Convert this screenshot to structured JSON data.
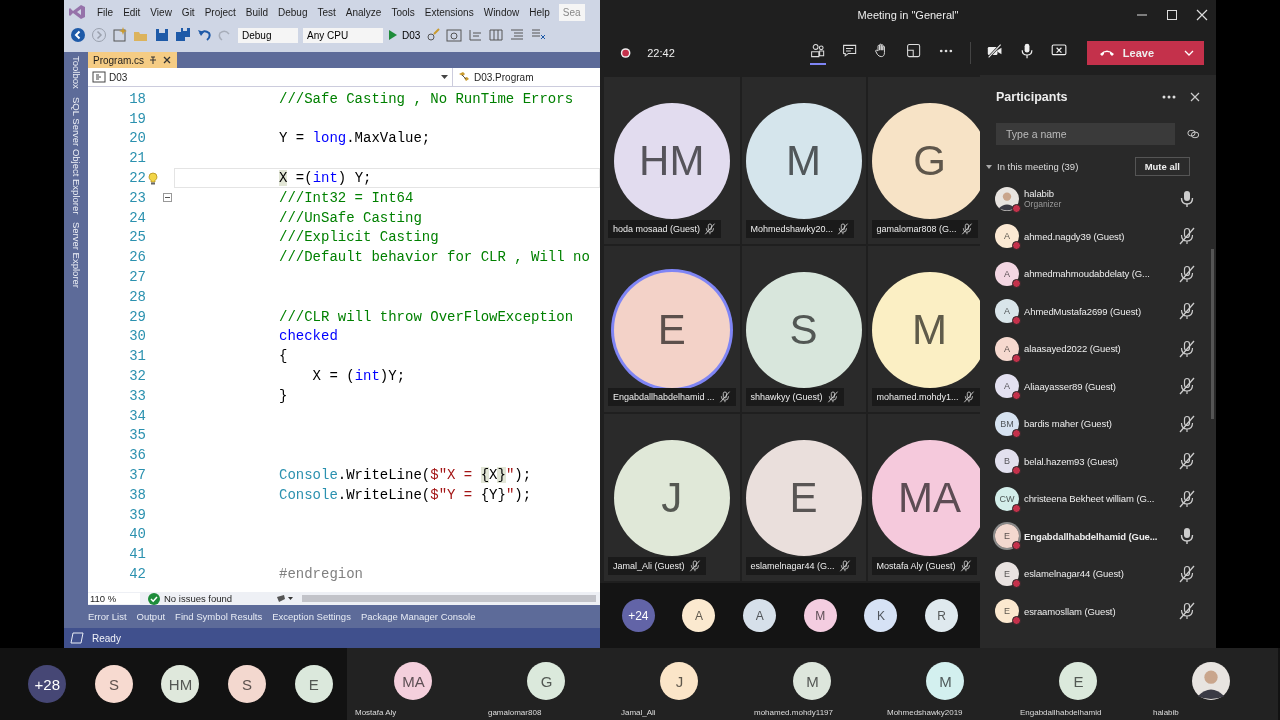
{
  "vs": {
    "menu": [
      "File",
      "Edit",
      "View",
      "Git",
      "Project",
      "Build",
      "Debug",
      "Test",
      "Analyze",
      "Tools",
      "Extensions",
      "Window",
      "Help",
      "Sea"
    ],
    "toolbar": {
      "config": "Debug",
      "platform": "Any CPU",
      "start": "D03"
    },
    "side_tabs": [
      "Toolbox",
      "SQL Server Object Explorer",
      "Server Explorer"
    ],
    "doc_tab": {
      "label": "Program.cs",
      "selected": true
    },
    "nav": {
      "project": "D03",
      "type": "D03.Program"
    },
    "code": [
      {
        "n": "18",
        "tokens": [
          {
            "t": "///Safe Casting , No RunTime Errors",
            "kind": "comment"
          }
        ]
      },
      {
        "n": "19"
      },
      {
        "n": "20",
        "tokens": [
          {
            "t": "Y = ",
            "kind": "plain"
          },
          {
            "t": "long",
            "kind": "keyword"
          },
          {
            "t": ".MaxValue;",
            "kind": "plain"
          }
        ]
      },
      {
        "n": "21"
      },
      {
        "n": "22",
        "current": true,
        "kind": "lightbulb",
        "tokens": [
          {
            "t": "X",
            "kind": "highlight"
          },
          {
            "t": " =(",
            "kind": "plain"
          },
          {
            "t": "int",
            "kind": "keyword"
          },
          {
            "t": ") Y;",
            "kind": "plain"
          }
        ]
      },
      {
        "n": "23",
        "kind": "collapse",
        "tokens": [
          {
            "t": "///Int32 = Int64",
            "kind": "comment"
          }
        ]
      },
      {
        "n": "24",
        "tokens": [
          {
            "t": "///UnSafe Casting",
            "kind": "comment"
          }
        ]
      },
      {
        "n": "25",
        "tokens": [
          {
            "t": "///Explicit Casting",
            "kind": "comment"
          }
        ]
      },
      {
        "n": "26",
        "tokens": [
          {
            "t": "///Default behavior for CLR , Will no",
            "kind": "comment"
          }
        ]
      },
      {
        "n": "27"
      },
      {
        "n": "28"
      },
      {
        "n": "29",
        "tokens": [
          {
            "t": "///CLR will throw OverFlowException",
            "kind": "comment"
          }
        ]
      },
      {
        "n": "30",
        "tokens": [
          {
            "t": "checked",
            "kind": "keyword"
          }
        ]
      },
      {
        "n": "31",
        "tokens": [
          {
            "t": "{",
            "kind": "plain"
          }
        ]
      },
      {
        "n": "32",
        "tokens": [
          {
            "t": "    X = (",
            "kind": "plain"
          },
          {
            "t": "int",
            "kind": "keyword"
          },
          {
            "t": ")Y;",
            "kind": "plain"
          }
        ]
      },
      {
        "n": "33",
        "tokens": [
          {
            "t": "}",
            "kind": "plain"
          }
        ]
      },
      {
        "n": "34"
      },
      {
        "n": "35"
      },
      {
        "n": "36"
      },
      {
        "n": "37",
        "tokens": [
          {
            "t": "Console",
            "kind": "type"
          },
          {
            "t": ".WriteLine(",
            "kind": "plain"
          },
          {
            "t": "$\"X = ",
            "kind": "string"
          },
          {
            "t": "{",
            "kind": "highlight"
          },
          {
            "t": "X",
            "kind": "plain"
          },
          {
            "t": "}",
            "kind": "highlight"
          },
          {
            "t": "\"",
            "kind": "string"
          },
          {
            "t": ");",
            "kind": "plain"
          }
        ]
      },
      {
        "n": "38",
        "tokens": [
          {
            "t": "Console",
            "kind": "type"
          },
          {
            "t": ".WriteLine(",
            "kind": "plain"
          },
          {
            "t": "$\"Y = ",
            "kind": "string"
          },
          {
            "t": "{Y}",
            "kind": "plain"
          },
          {
            "t": "\"",
            "kind": "string"
          },
          {
            "t": ");",
            "kind": "plain"
          }
        ]
      },
      {
        "n": "39"
      },
      {
        "n": "40"
      },
      {
        "n": "41"
      },
      {
        "n": "42",
        "tokens": [
          {
            "t": "#endregion",
            "kind": "preproc"
          }
        ]
      }
    ],
    "zoom": "110 %",
    "issues": "No issues found",
    "tool_tabs": [
      "Error List",
      "Output",
      "Find Symbol Results",
      "Exception Settings",
      "Package Manager Console"
    ],
    "status": "Ready"
  },
  "teams": {
    "title": "Meeting in \"General\"",
    "timer": "22:42",
    "toolbar": [
      {
        "kind": "people",
        "selected": true
      },
      {
        "kind": "chat",
        "selected": false
      },
      {
        "kind": "hand",
        "selected": false
      },
      {
        "kind": "rooms",
        "selected": false
      },
      {
        "kind": "more",
        "selected": false
      },
      {
        "kind": "camera-off",
        "selected": false
      },
      {
        "kind": "mic",
        "selected": false
      },
      {
        "kind": "share",
        "selected": false
      }
    ],
    "leave": "Leave",
    "grid": [
      {
        "initials": "HM",
        "name": "hoda mosaad (Guest)",
        "color": "#e2dcef",
        "speaking": false
      },
      {
        "initials": "M",
        "name": "Mohmedshawky20...",
        "color": "#d5e5ec",
        "speaking": false
      },
      {
        "initials": "G",
        "name": "gamalomar808 (G...",
        "color": "#f7e3c6",
        "speaking": false
      },
      {
        "initials": "E",
        "name": "Engabdallhabdelhamid ...",
        "color": "#f3d2c8",
        "speaking": true
      },
      {
        "initials": "S",
        "name": "shhawkyy (Guest)",
        "color": "#d8e6dc",
        "speaking": false
      },
      {
        "initials": "M",
        "name": "mohamed.mohdy1...",
        "color": "#fbefc4",
        "speaking": false
      },
      {
        "initials": "J",
        "name": "Jamal_Ali (Guest)",
        "color": "#e0e8d8",
        "speaking": false
      },
      {
        "initials": "E",
        "name": "eslamelnagar44 (G...",
        "color": "#eadfdc",
        "speaking": false
      },
      {
        "initials": "MA",
        "name": "Mostafa Aly (Guest)",
        "color": "#f5c9dc",
        "speaking": false
      }
    ],
    "overflow": [
      {
        "initials": "+24",
        "color": "#6264a7"
      },
      {
        "initials": "A",
        "color": "#fbe9cf"
      },
      {
        "initials": "A",
        "color": "#d6e0ea"
      },
      {
        "initials": "M",
        "color": "#f4cde0"
      },
      {
        "initials": "K",
        "color": "#d6e2f5"
      },
      {
        "initials": "R",
        "color": "#dfe9ee"
      }
    ],
    "participants": {
      "title": "Participants",
      "search_placeholder": "Type a name",
      "section": "In this meeting (39)",
      "mute_all": "Mute all",
      "people": [
        {
          "kind": "photo",
          "name": "halabib",
          "role": "Organizer",
          "muted": false,
          "speaking": false
        },
        {
          "kind": "initials",
          "initials": "A",
          "name": "ahmed.nagdy39 (Guest)",
          "color": "#fbe9d3",
          "muted": true,
          "speaking": false
        },
        {
          "kind": "initials",
          "initials": "A",
          "name": "ahmedmahmoudabdelaty (G...",
          "color": "#f3d6e2",
          "muted": true,
          "speaking": false
        },
        {
          "kind": "initials",
          "initials": "A",
          "name": "AhmedMustafa2699 (Guest)",
          "color": "#d9e5ea",
          "muted": true,
          "speaking": false
        },
        {
          "kind": "initials",
          "initials": "A",
          "name": "alaasayed2022 (Guest)",
          "color": "#f6d9cf",
          "muted": true,
          "speaking": false
        },
        {
          "kind": "initials",
          "initials": "A",
          "name": "Aliaayasser89 (Guest)",
          "color": "#e3e0f0",
          "muted": true,
          "speaking": false
        },
        {
          "kind": "initials",
          "initials": "BM",
          "name": "bardis maher (Guest)",
          "color": "#d6e2f0",
          "muted": true,
          "speaking": false
        },
        {
          "kind": "initials",
          "initials": "B",
          "name": "belal.hazem93 (Guest)",
          "color": "#e2e0ee",
          "muted": true,
          "speaking": false
        },
        {
          "kind": "initials",
          "initials": "CW",
          "name": "christeena Bekheet william (G...",
          "color": "#d3eeea",
          "muted": true,
          "speaking": false
        },
        {
          "kind": "initials",
          "initials": "E",
          "name": "Engabdallhabdelhamid (Gue...",
          "color": "#f3d8cf",
          "muted": false,
          "speaking": true
        },
        {
          "kind": "initials",
          "initials": "E",
          "name": "eslamelnagar44 (Guest)",
          "color": "#e8e2e0",
          "muted": true,
          "speaking": false
        },
        {
          "kind": "initials",
          "initials": "E",
          "name": "esraamosllam (Guest)",
          "color": "#fbe8cf",
          "muted": true,
          "speaking": false
        }
      ]
    }
  },
  "strip": [
    {
      "kind": "circle",
      "initials": "+28",
      "color": "#464775"
    },
    {
      "kind": "circle",
      "initials": "S",
      "color": "#f7dad0"
    },
    {
      "kind": "circle",
      "initials": "HM",
      "color": "#dfe8dc"
    },
    {
      "kind": "circle",
      "initials": "S",
      "color": "#f3d8cf"
    },
    {
      "kind": "circle",
      "initials": "E",
      "color": "#dbe8dc"
    },
    {
      "kind": "tile",
      "initials": "MA",
      "name": "Mostafa Aly",
      "color": "#f4cfdc"
    },
    {
      "kind": "tile",
      "initials": "G",
      "name": "gamalomar808",
      "color": "#dbe9dc"
    },
    {
      "kind": "tile",
      "initials": "J",
      "name": "Jamal_Ali",
      "color": "#fbe5c8"
    },
    {
      "kind": "tile",
      "initials": "M",
      "name": "mohamed.mohdy1197",
      "color": "#dde6dc"
    },
    {
      "kind": "tile",
      "initials": "M",
      "name": "Mohmedshawky2019",
      "color": "#d3f0ef"
    },
    {
      "kind": "tile",
      "initials": "E",
      "name": "Engabdallhabdelhamid",
      "color": "#dbe9dc"
    },
    {
      "kind": "photo",
      "name": "halabib"
    }
  ]
}
